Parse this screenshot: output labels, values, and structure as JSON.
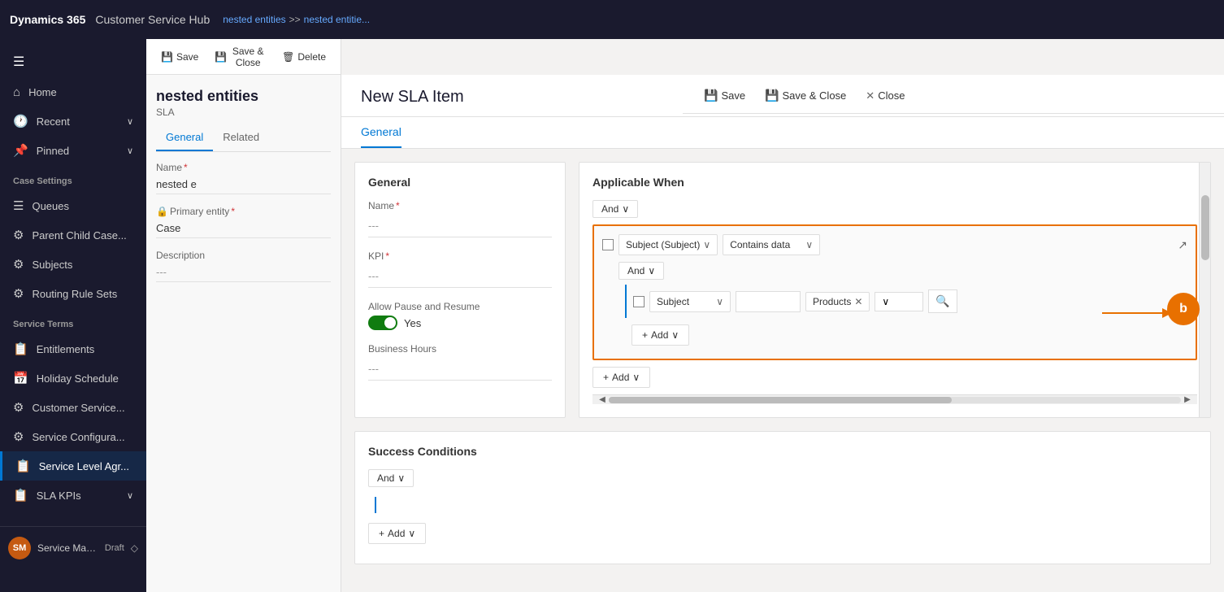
{
  "topNav": {
    "dynamics": "Dynamics 365",
    "hub": "Customer Service Hub",
    "breadcrumb": [
      "nested entities",
      ">>",
      "nested entitie..."
    ]
  },
  "commandBar": {
    "save": "Save",
    "saveClose": "Save & Close",
    "close": "Close"
  },
  "sidebar": {
    "hamburger": "☰",
    "items": [
      {
        "id": "home",
        "icon": "⌂",
        "label": "Home"
      },
      {
        "id": "recent",
        "icon": "🕐",
        "label": "Recent",
        "hasChevron": true
      },
      {
        "id": "pinned",
        "icon": "📌",
        "label": "Pinned",
        "hasChevron": true
      }
    ],
    "sections": [
      {
        "title": "Case Settings",
        "items": [
          {
            "id": "queues",
            "icon": "☰",
            "label": "Queues"
          },
          {
            "id": "parent-child",
            "icon": "⚙",
            "label": "Parent Child Case..."
          },
          {
            "id": "subjects",
            "icon": "⚙",
            "label": "Subjects"
          },
          {
            "id": "routing",
            "icon": "⚙",
            "label": "Routing Rule Sets"
          }
        ]
      },
      {
        "title": "Service Terms",
        "items": [
          {
            "id": "entitlements",
            "icon": "📋",
            "label": "Entitlements"
          },
          {
            "id": "holiday",
            "icon": "📅",
            "label": "Holiday Schedule"
          },
          {
            "id": "customer-service",
            "icon": "⚙",
            "label": "Customer Service..."
          },
          {
            "id": "service-config",
            "icon": "⚙",
            "label": "Service Configura..."
          },
          {
            "id": "service-level",
            "icon": "📋",
            "label": "Service Level Agr...",
            "highlighted": true
          },
          {
            "id": "sla-kpis",
            "icon": "📋",
            "label": "SLA KPIs",
            "hasChevron": true
          }
        ]
      }
    ],
    "footer": {
      "initials": "SM",
      "label": "Service Managem...",
      "status": "Draft"
    }
  },
  "middlePanel": {
    "commands": [
      "Save",
      "Save & Close",
      "Delete"
    ],
    "record": {
      "title": "nested entities",
      "subtitle": "SLA",
      "tabs": [
        "General",
        "Related"
      ],
      "fields": [
        {
          "label": "Name",
          "required": true,
          "value": "nested e"
        },
        {
          "label": "Primary entity",
          "required": true,
          "value": "Case"
        },
        {
          "label": "Description",
          "required": false,
          "value": "---"
        }
      ]
    }
  },
  "form": {
    "title": "New SLA Item",
    "breadcrumbRight": {
      "label": "nested entities",
      "sublabel": "SLA"
    },
    "tabs": [
      "General"
    ],
    "sections": {
      "general": {
        "title": "General",
        "fields": [
          {
            "label": "Name",
            "required": true,
            "value": "---"
          },
          {
            "label": "KPI",
            "required": true,
            "value": "---"
          },
          {
            "label": "Allow Pause and Resume",
            "type": "toggle",
            "value": "Yes"
          },
          {
            "label": "Business Hours",
            "value": "---"
          }
        ]
      },
      "applicableWhen": {
        "title": "Applicable When",
        "andLabel": "And",
        "outerCondition": {
          "fieldSelector": "Subject (Subject)",
          "operator": "Contains data"
        },
        "nestedAnd": "And",
        "innerCondition": {
          "field": "Subject",
          "inputValue": "",
          "tag": "Products",
          "dropdownValue": ""
        },
        "addLabel": "+ Add",
        "outerAddLabel": "+ Add"
      },
      "successConditions": {
        "title": "Success Conditions",
        "andLabel": "And",
        "addLabel": "+ Add"
      }
    },
    "annotation": {
      "letter": "b"
    }
  }
}
